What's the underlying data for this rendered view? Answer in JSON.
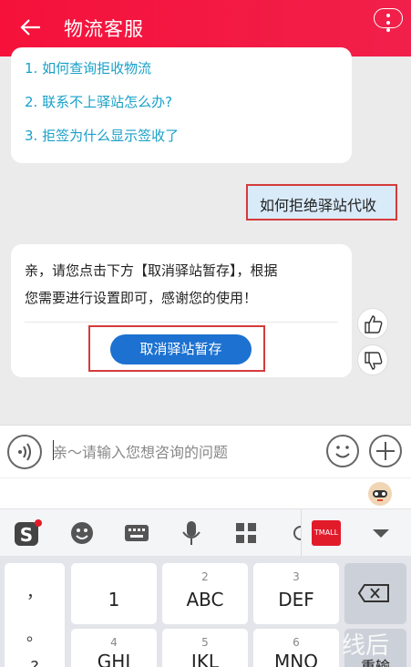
{
  "header": {
    "title": "物流客服"
  },
  "faq": {
    "items": [
      "1. 如何查询拒收物流",
      "2. 联系不上驿站怎么办?",
      "3. 拒签为什么显示签收了"
    ]
  },
  "user_message": "如何拒绝驿站代收",
  "reply": {
    "line1": "亲，请您点击下方【取消驿站暂存】，根据",
    "line2": "您需要进行设置即可，感谢您的使用！",
    "button_label": "取消驿站暂存"
  },
  "input": {
    "placeholder": "亲～请输入您想咨询的问题"
  },
  "toolbar": {
    "tmall_label": "TMALL"
  },
  "keyboard": {
    "symbols": [
      "，",
      "。",
      "?"
    ],
    "row1": [
      {
        "num": "",
        "label": "1"
      },
      {
        "num": "2",
        "label": "ABC"
      },
      {
        "num": "3",
        "label": "DEF"
      }
    ],
    "row2": [
      {
        "num": "4",
        "label": "GHI"
      },
      {
        "num": "5",
        "label": "JKL"
      },
      {
        "num": "6",
        "label": "MNO"
      }
    ],
    "enter_label": "重输"
  },
  "watermark": "线后",
  "colors": {
    "brand_red": "#f5113a",
    "link_blue": "#19a0c8",
    "button_blue": "#1d71d0",
    "highlight": "#d53b3b"
  }
}
